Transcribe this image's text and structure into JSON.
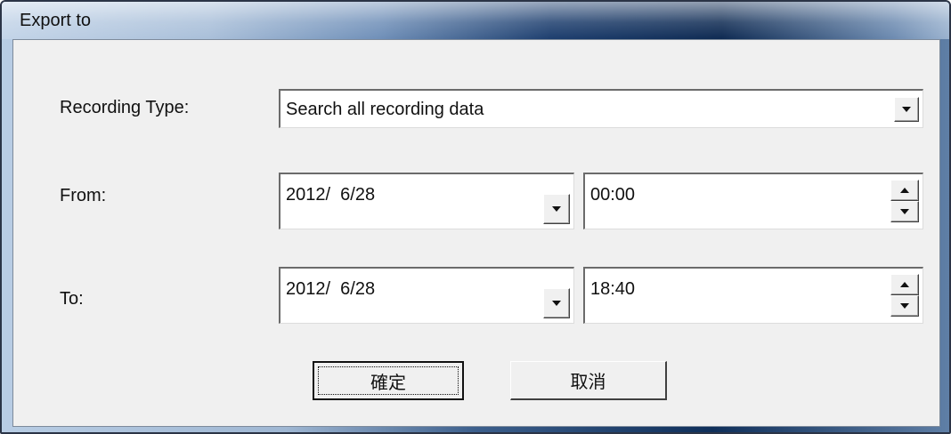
{
  "window": {
    "title": "Export to"
  },
  "recording_type": {
    "label": "Recording Type:",
    "value": "Search all recording data"
  },
  "from": {
    "label": "From:",
    "date": "2012/  6/28",
    "time": "00:00"
  },
  "to": {
    "label": "To:",
    "date": "2012/  6/28",
    "time": "18:40"
  },
  "buttons": {
    "ok_label": "確定",
    "cancel_label": "取消"
  },
  "icons": {
    "dropdown": "chevron-down-icon",
    "spin_up": "chevron-up-icon",
    "spin_down": "chevron-down-icon"
  }
}
